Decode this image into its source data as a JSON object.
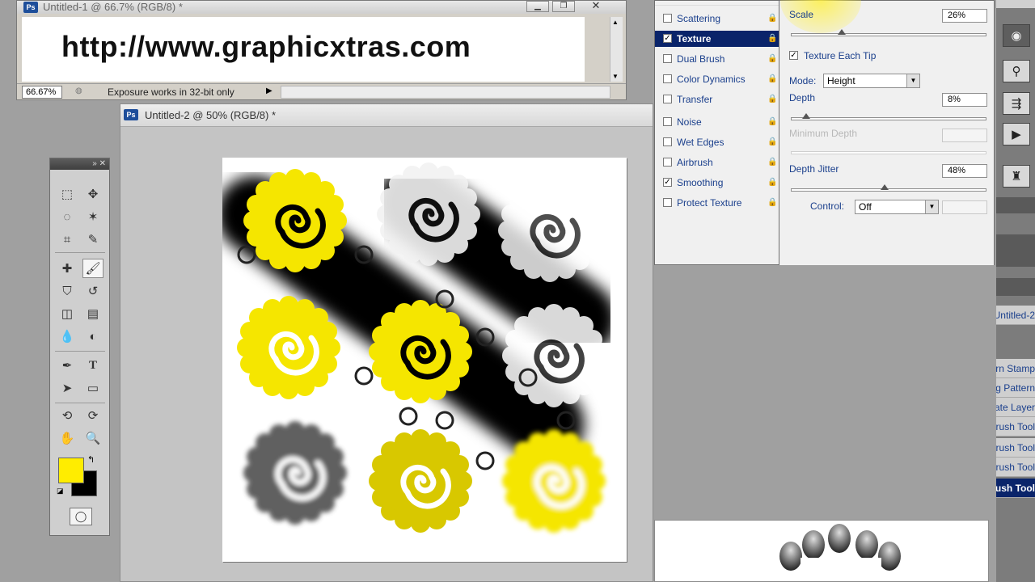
{
  "doc1": {
    "title": "Untitled-1 @ 66.7% (RGB/8) *",
    "url_text": "http://www.graphicxtras.com",
    "zoom": "66.67%",
    "status": "Exposure works in 32-bit only"
  },
  "doc2": {
    "title": "Untitled-2 @ 50% (RGB/8) *"
  },
  "tools": {
    "foreground_color": "#ffed00",
    "background_color": "#000000"
  },
  "brush_list": {
    "items": [
      {
        "label": "Scattering",
        "checked": false,
        "selected": false
      },
      {
        "label": "Texture",
        "checked": true,
        "selected": true
      },
      {
        "label": "Dual Brush",
        "checked": false,
        "selected": false
      },
      {
        "label": "Color Dynamics",
        "checked": false,
        "selected": false
      },
      {
        "label": "Transfer",
        "checked": false,
        "selected": false
      },
      {
        "label": "Noise",
        "checked": false,
        "selected": false
      },
      {
        "label": "Wet Edges",
        "checked": false,
        "selected": false
      },
      {
        "label": "Airbrush",
        "checked": false,
        "selected": false
      },
      {
        "label": "Smoothing",
        "checked": true,
        "selected": false
      },
      {
        "label": "Protect Texture",
        "checked": false,
        "selected": false
      }
    ]
  },
  "brush_options": {
    "scale_label": "Scale",
    "scale_value": "26%",
    "scale_level": 0.26,
    "texture_each_tip_label": "Texture Each Tip",
    "texture_each_tip_checked": true,
    "mode_label": "Mode:",
    "mode_value": "Height",
    "depth_label": "Depth",
    "depth_value": "8%",
    "depth_level": 0.08,
    "minimum_depth_label": "Minimum Depth",
    "depth_jitter_label": "Depth Jitter",
    "depth_jitter_value": "48%",
    "depth_jitter_level": 0.48,
    "control_label": "Control:",
    "control_value": "Off"
  },
  "dock": {
    "items": [
      {
        "label": "Untitled-2",
        "selected": false
      },
      {
        "label": "Pattern Stamp",
        "selected": false
      },
      {
        "label": "Healing Pattern",
        "selected": false
      },
      {
        "label": "Duplicate Layer",
        "selected": false
      },
      {
        "label": "Brush Tool",
        "selected": false
      },
      {
        "label": "Brush Tool",
        "selected": false
      },
      {
        "label": "Brush Tool",
        "selected": false
      },
      {
        "label": "Brush Tool",
        "selected": true
      }
    ]
  }
}
